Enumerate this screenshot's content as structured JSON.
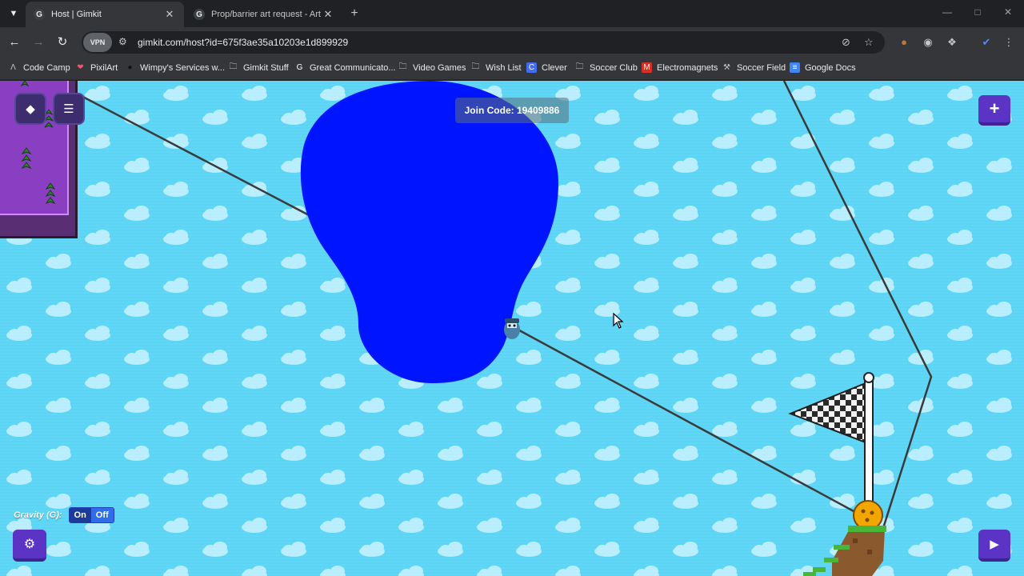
{
  "browser": {
    "tabs": [
      {
        "favicon": "G",
        "title": "Host | Gimkit",
        "active": true
      },
      {
        "favicon": "G",
        "title": "Prop/barrier art request - Art -",
        "active": false
      }
    ],
    "url": "gimkit.com/host?id=675f3ae35a10203e1d899929",
    "vpn_label": "VPN",
    "bookmarks": [
      {
        "icon": "code-camp-icon",
        "label": "Code Camp"
      },
      {
        "icon": "heart-icon",
        "label": "PixilArt"
      },
      {
        "icon": "circle-icon",
        "label": "Wimpy's Services w..."
      },
      {
        "icon": "folder-icon",
        "label": "Gimkit Stuff"
      },
      {
        "icon": "google-icon",
        "label": "Great Communicato..."
      },
      {
        "icon": "folder-icon",
        "label": "Video Games"
      },
      {
        "icon": "folder-icon",
        "label": "Wish List"
      },
      {
        "icon": "clever-icon",
        "label": "Clever"
      },
      {
        "icon": "folder-icon",
        "label": "Soccer Club"
      },
      {
        "icon": "m-icon",
        "label": "Electromagnets"
      },
      {
        "icon": "tools-icon",
        "label": "Soccer Field"
      },
      {
        "icon": "docs-icon",
        "label": "Google Docs"
      }
    ]
  },
  "game": {
    "join_code": "Join Code: 19409886",
    "gravity_label": "Gravity (G):",
    "gravity_on": "On",
    "gravity_off": "Off",
    "gravity_state": "off",
    "colors": {
      "sky": "#5bd4f5",
      "blob": "#0015ff",
      "button": "#5b34c5"
    }
  }
}
